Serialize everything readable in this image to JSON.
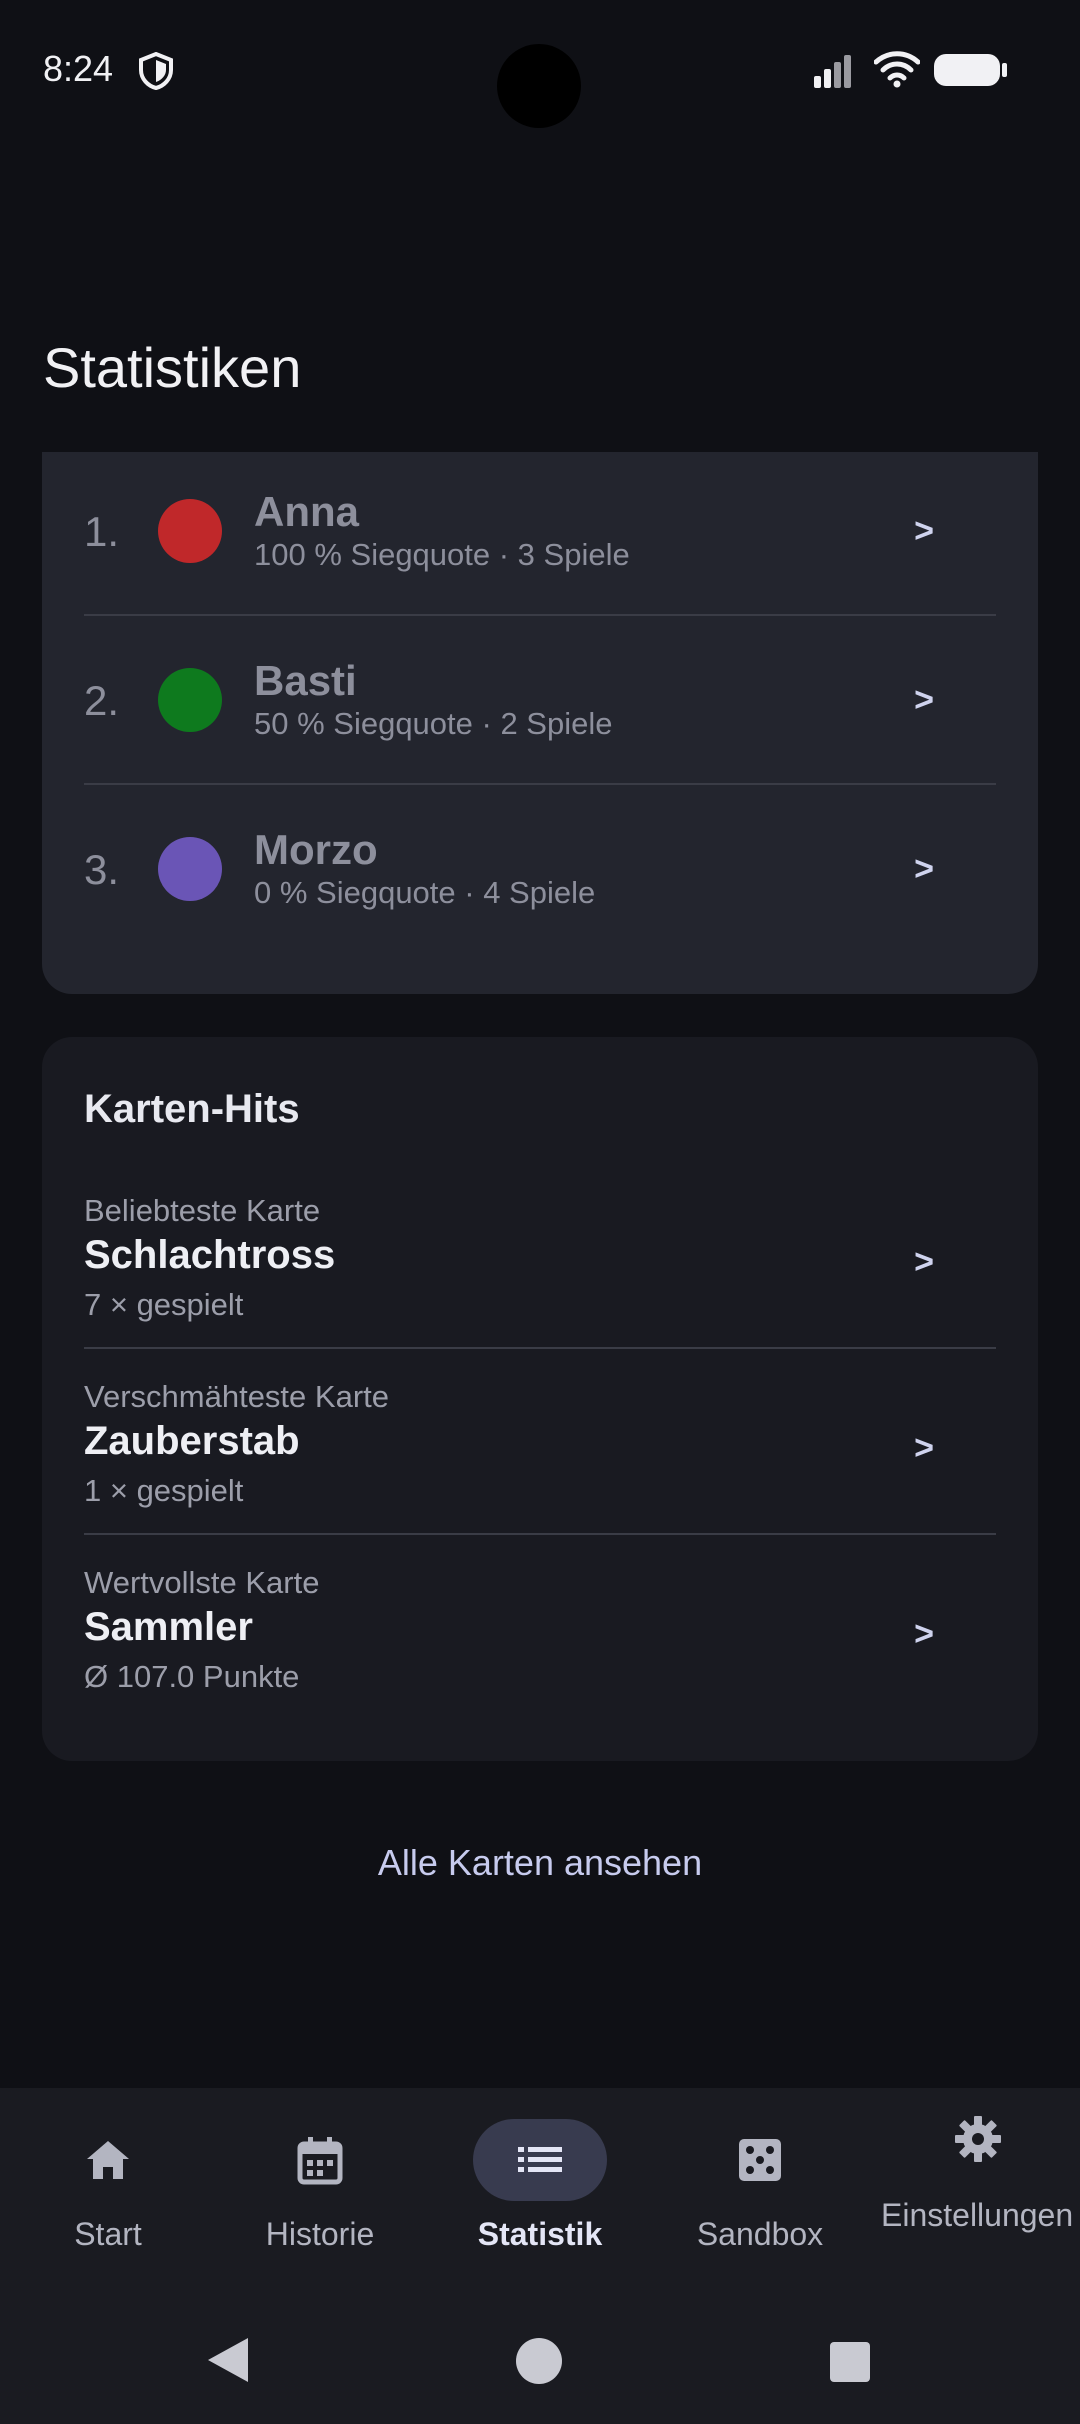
{
  "status_bar": {
    "time": "8:24"
  },
  "page": {
    "title": "Statistiken"
  },
  "players": [
    {
      "rank": "1.",
      "name": "Anna",
      "sub": "100 % Siegquote · 3 Spiele",
      "color": "#c0282a"
    },
    {
      "rank": "2.",
      "name": "Basti",
      "sub": "50 % Siegquote · 2 Spiele",
      "color": "#0e7a1e"
    },
    {
      "rank": "3.",
      "name": "Morzo",
      "sub": "0 % Siegquote · 4 Spiele",
      "color": "#6a55b6"
    }
  ],
  "chevron": ">",
  "hits": {
    "title": "Karten-Hits",
    "items": [
      {
        "label": "Beliebteste Karte",
        "name": "Schlachtross",
        "sub": "7 × gespielt"
      },
      {
        "label": "Verschmähteste Karte",
        "name": "Zauberstab",
        "sub": "1 × gespielt"
      },
      {
        "label": "Wertvollste Karte",
        "name": "Sammler",
        "sub": "Ø 107.0 Punkte"
      }
    ]
  },
  "all_cards_link": "Alle Karten ansehen",
  "nav": {
    "items": [
      {
        "label": "Start",
        "icon": "home-icon"
      },
      {
        "label": "Historie",
        "icon": "calendar-icon"
      },
      {
        "label": "Statistik",
        "icon": "list-icon",
        "active": true
      },
      {
        "label": "Sandbox",
        "icon": "dice-icon"
      },
      {
        "label": "Einstellungen",
        "icon": "gear-icon"
      }
    ]
  }
}
